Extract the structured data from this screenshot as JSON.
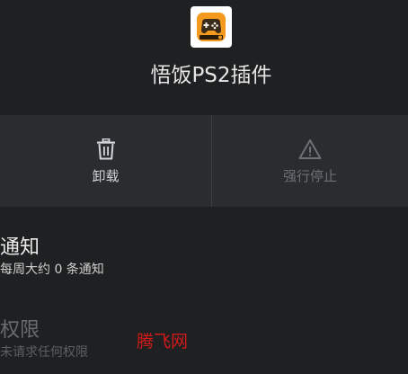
{
  "app": {
    "name": "悟饭PS2插件",
    "icon": "gamepad-app-icon"
  },
  "actions": {
    "uninstall": {
      "label": "卸载",
      "icon": "trash-icon"
    },
    "force_stop": {
      "label": "强行停止",
      "icon": "warning-triangle-icon",
      "enabled": false
    }
  },
  "notifications": {
    "title": "通知",
    "summary": "每周大约 0 条通知"
  },
  "permissions": {
    "title": "权限",
    "summary": "未请求任何权限"
  },
  "watermark": "腾飞网",
  "colors": {
    "background": "#1f2021",
    "action_bar": "#2a2c2f",
    "watermark": "#d21a1a",
    "icon_orange": "#f39a1e"
  }
}
